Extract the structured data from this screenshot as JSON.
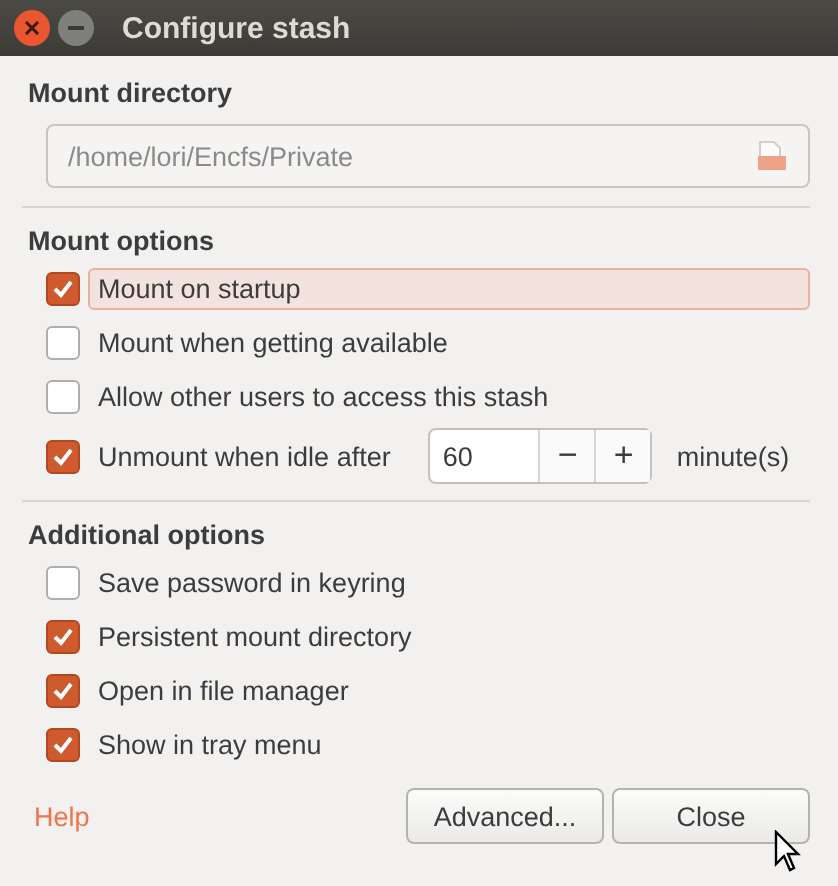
{
  "window": {
    "title": "Configure stash"
  },
  "sections": [
    {
      "kind": "directory",
      "title": "Mount directory",
      "path": "/home/lori/Encfs/Private"
    },
    {
      "kind": "options",
      "title": "Mount options",
      "options": [
        {
          "kind": "check",
          "label": "Mount on startup",
          "checked": true,
          "focused": true
        },
        {
          "kind": "check",
          "label": "Mount when getting available",
          "checked": false,
          "focused": false
        },
        {
          "kind": "check",
          "label": "Allow other users to access this stash",
          "checked": false,
          "focused": false
        },
        {
          "kind": "spin",
          "label": "Unmount when idle after",
          "checked": true,
          "focused": false,
          "value": "60",
          "minus": "−",
          "plus": "+",
          "unit": "minute(s)"
        }
      ]
    },
    {
      "kind": "options",
      "title": "Additional options",
      "options": [
        {
          "kind": "check",
          "label": "Save password in keyring",
          "checked": false,
          "focused": false
        },
        {
          "kind": "check",
          "label": "Persistent mount directory",
          "checked": true,
          "focused": false
        },
        {
          "kind": "check",
          "label": "Open in file manager",
          "checked": true,
          "focused": false
        },
        {
          "kind": "check",
          "label": "Show in tray menu",
          "checked": true,
          "focused": false
        }
      ]
    }
  ],
  "footer": {
    "help": "Help",
    "buttons": [
      "Advanced...",
      "Close"
    ]
  }
}
